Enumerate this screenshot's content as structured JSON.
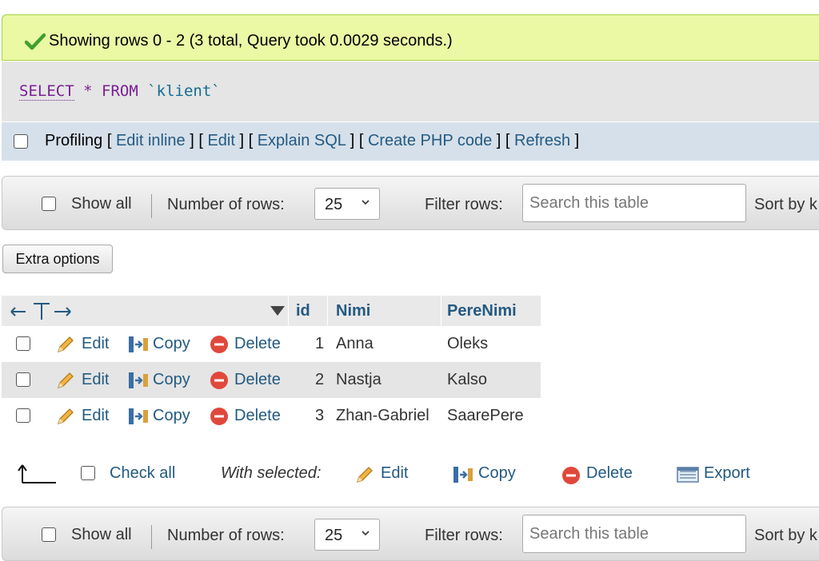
{
  "banner": {
    "message": "Showing rows 0 - 2 (3 total, Query took 0.0029 seconds.)"
  },
  "sql": {
    "select": "SELECT",
    "star": "*",
    "from": "FROM",
    "table": "`klient`"
  },
  "profiling": {
    "label": "Profiling",
    "links": [
      "Edit inline",
      "Edit",
      "Explain SQL",
      "Create PHP code",
      "Refresh"
    ]
  },
  "nav": {
    "show_all": "Show all",
    "number_of_rows_label": "Number of rows:",
    "number_of_rows_value": "25",
    "filter_label": "Filter rows:",
    "search_placeholder": "Search this table",
    "sort_label": "Sort by k"
  },
  "extra_options": "Extra options",
  "table": {
    "columns": [
      "id",
      "Nimi",
      "PereNimi"
    ],
    "actions": {
      "edit": "Edit",
      "copy": "Copy",
      "delete": "Delete"
    },
    "rows": [
      {
        "id": "1",
        "nimi": "Anna",
        "perenimi": "Oleks"
      },
      {
        "id": "2",
        "nimi": "Nastja",
        "perenimi": "Kalso"
      },
      {
        "id": "3",
        "nimi": "Zhan-Gabriel",
        "perenimi": "SaarePere"
      }
    ]
  },
  "bulk": {
    "check_all": "Check all",
    "with_selected": "With selected:",
    "edit": "Edit",
    "copy": "Copy",
    "delete": "Delete",
    "export": "Export"
  },
  "colors": {
    "link": "#235a81",
    "success_bg": "#ebf8a4",
    "keyword": "#7a1f94"
  }
}
